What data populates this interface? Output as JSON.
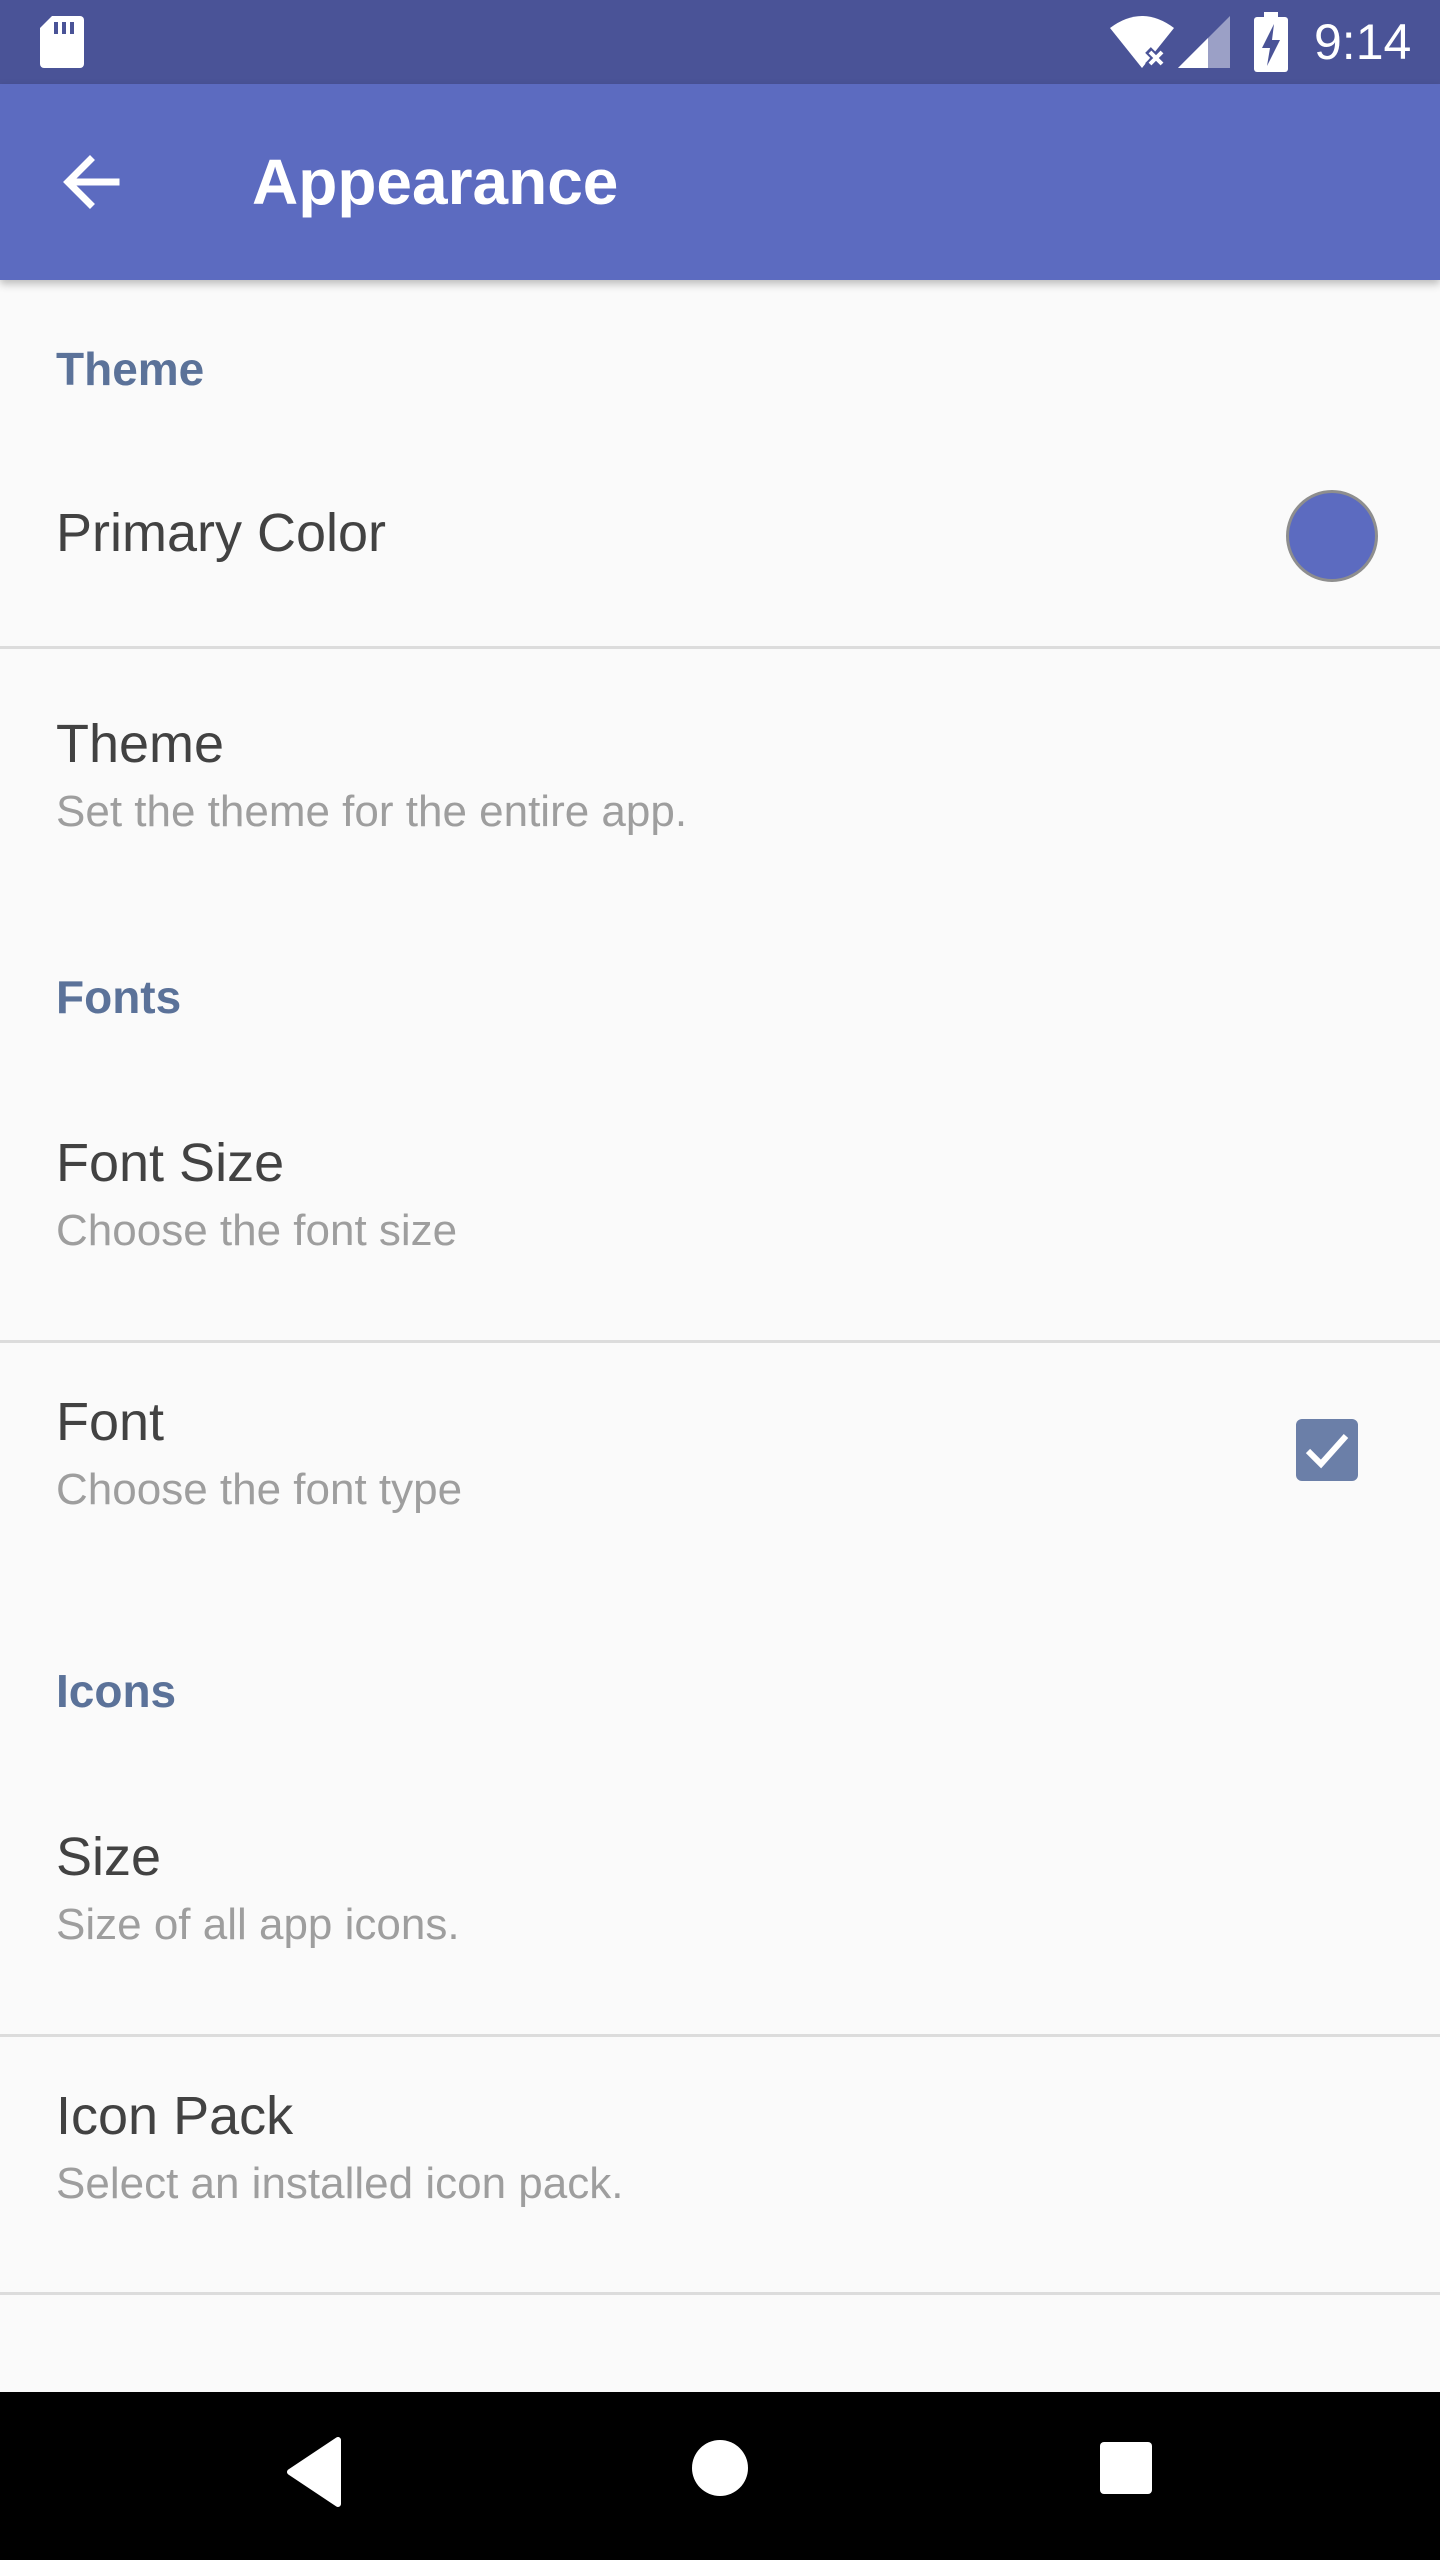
{
  "status_bar": {
    "time": "9:14",
    "icons": [
      "sd-card-icon",
      "wifi-icon",
      "signal-icon",
      "battery-charging-icon"
    ]
  },
  "app_bar": {
    "back_icon": "arrow-back-icon",
    "title": "Appearance"
  },
  "colors": {
    "status_bar": "#4a5397",
    "app_bar": "#5c6bc0",
    "category_text": "#5b7299",
    "primary_color_swatch": "#5c6bc0",
    "checkbox": "#6b7fa8"
  },
  "sections": [
    {
      "header": "Theme",
      "items": [
        {
          "title": "Primary Color",
          "summary": "",
          "widget": "color-swatch"
        },
        {
          "title": "Theme",
          "summary": "Set the theme for the entire app.",
          "widget": ""
        }
      ]
    },
    {
      "header": "Fonts",
      "items": [
        {
          "title": "Font Size",
          "summary": "Choose the font size",
          "widget": ""
        },
        {
          "title": "Font",
          "summary": "Choose the font type",
          "widget": "checkbox",
          "checked": true
        }
      ]
    },
    {
      "header": "Icons",
      "items": [
        {
          "title": "Size",
          "summary": "Size of all app icons.",
          "widget": ""
        },
        {
          "title": "Icon Pack",
          "summary": "Select an installed icon pack.",
          "widget": ""
        }
      ]
    }
  ],
  "nav_bar": {
    "icons": [
      "nav-back-icon",
      "nav-home-icon",
      "nav-recents-icon"
    ]
  }
}
